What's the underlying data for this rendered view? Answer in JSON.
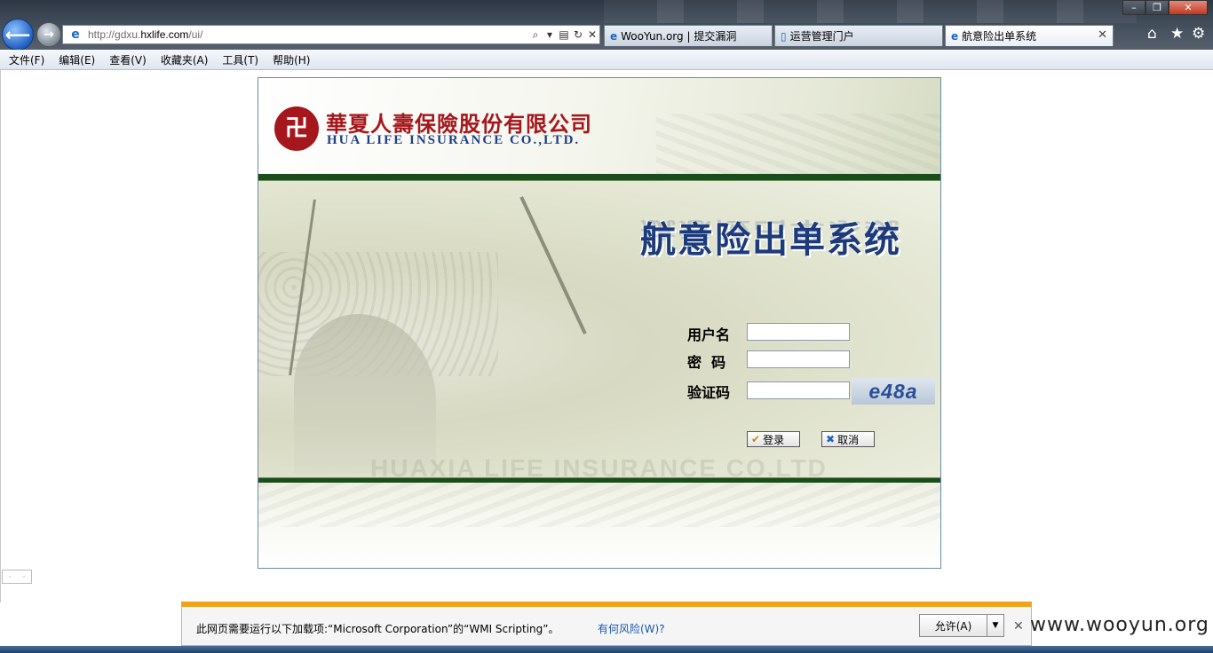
{
  "browser": {
    "url_prefix": "http://gdxu.",
    "url_domain": "hxlife.com",
    "url_suffix": "/ui/",
    "tabs": [
      {
        "label": "WooYun.org | 提交漏洞"
      },
      {
        "label": "运营管理门户"
      },
      {
        "label": "航意险出单系统"
      }
    ],
    "window_controls": {
      "minimize": "–",
      "maximize": "❐",
      "close": "✕"
    }
  },
  "menubar": {
    "items": [
      "文件(F)",
      "编辑(E)",
      "查看(V)",
      "收藏夹(A)",
      "工具(T)",
      "帮助(H)"
    ]
  },
  "login": {
    "logo_glyph": "卍",
    "company_cn": "華夏人壽保險股份有限公司",
    "company_en": "HUA LIFE INSURANCE CO.,LTD.",
    "system_title": "航意险出单系统",
    "username_label": "用户名",
    "password_label": "密  码",
    "captcha_label": "验证码",
    "username_value": "",
    "password_value": "",
    "captcha_value": "",
    "captcha_text": "e48a",
    "login_button": "登录",
    "cancel_button": "取消",
    "watermark": "HUAXIA LIFE INSURANCE CO.LTD"
  },
  "notification": {
    "message": "此网页需要运行以下加载项:“Microsoft Corporation”的“WMI Scripting”。",
    "link": "有何风险(W)?",
    "allow_button": "允许(A)"
  },
  "watermark_site": "www.wooyun.org",
  "colors": {
    "brand_red": "#a5171c",
    "brand_blue": "#1d3a7a",
    "band_green": "#1b4d1c",
    "notify_accent": "#f0a218"
  }
}
